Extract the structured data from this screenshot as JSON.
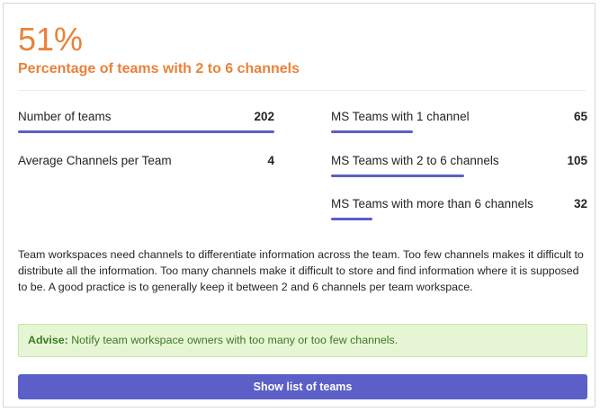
{
  "headline": {
    "percent": "51%",
    "subtitle": "Percentage of teams with 2 to 6 channels"
  },
  "metrics_left": [
    {
      "label": "Number of teams",
      "value": "202",
      "bar_fraction": 1.0
    },
    {
      "label": "Average Channels per Team",
      "value": "4",
      "bar_fraction": null
    }
  ],
  "metrics_right": [
    {
      "label": "MS Teams with 1 channel",
      "value": "65",
      "bar_fraction": 0.32
    },
    {
      "label": "MS Teams with 2 to 6 channels",
      "value": "105",
      "bar_fraction": 0.52
    },
    {
      "label": "MS Teams with more than 6 channels",
      "value": "32",
      "bar_fraction": 0.16
    }
  ],
  "description": "Team workspaces need channels to differentiate information across the team. Too few channels makes it difficult to distribute all the information. Too many channels make it difficult to store and find information where it is supposed to be. A good practice is to generally keep it between 2 and 6 channels per team workspace.",
  "advise": {
    "tag": "Advise:",
    "text": "Notify team workspace owners with too many or too few channels."
  },
  "button": {
    "label": "Show list of teams"
  },
  "colors": {
    "accent_orange": "#e8823a",
    "bar_purple": "#5b5fc7",
    "advise_bg": "#e6f6d4",
    "advise_text": "#3c7a23"
  }
}
